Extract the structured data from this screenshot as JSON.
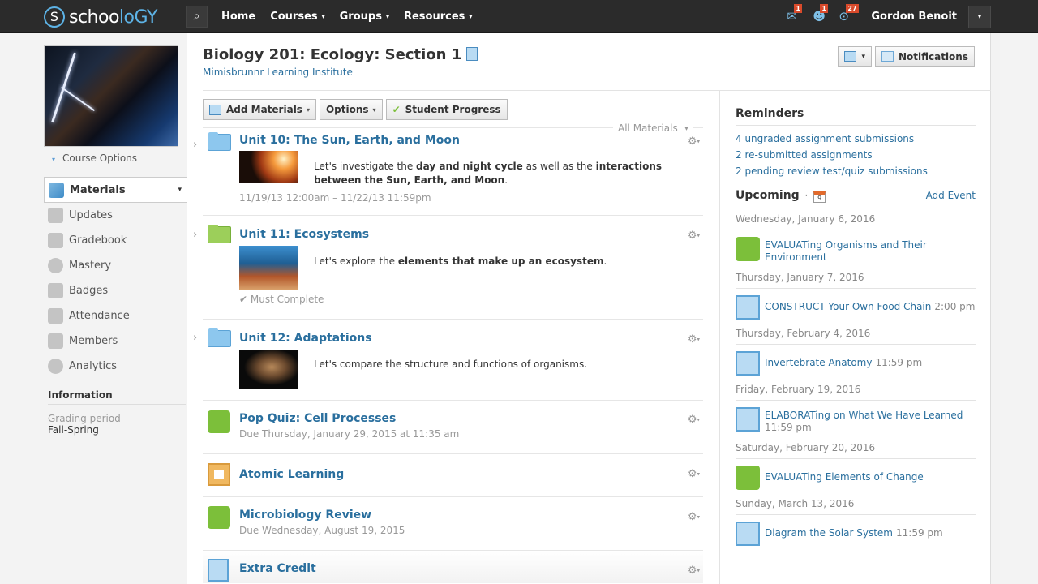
{
  "topbar": {
    "logo_letter": "S",
    "logo_text_main": "schoo",
    "logo_text_accent": "lοGY",
    "search_icon": "⌕",
    "nav": [
      {
        "label": "Home",
        "has_menu": false
      },
      {
        "label": "Courses",
        "has_menu": true
      },
      {
        "label": "Groups",
        "has_menu": true
      },
      {
        "label": "Resources",
        "has_menu": true
      }
    ],
    "caret": "▾",
    "icons": [
      {
        "name": "messages-icon",
        "glyph": "✉",
        "count": "1"
      },
      {
        "name": "requests-icon",
        "glyph": "☻",
        "count": "1"
      },
      {
        "name": "notifications-icon",
        "glyph": "⊙",
        "count": "27"
      }
    ],
    "user_name": "Gordon Benoit",
    "user_menu_caret": "▾"
  },
  "sidebar": {
    "course_options": "Course Options",
    "course_options_caret": "▾",
    "items": [
      {
        "label": "Materials",
        "active": true,
        "icon": "materials-icon"
      },
      {
        "label": "Updates",
        "active": false,
        "icon": "updates-icon"
      },
      {
        "label": "Gradebook",
        "active": false,
        "icon": "gradebook-icon"
      },
      {
        "label": "Mastery",
        "active": false,
        "icon": "mastery-icon"
      },
      {
        "label": "Badges",
        "active": false,
        "icon": "badges-icon"
      },
      {
        "label": "Attendance",
        "active": false,
        "icon": "attendance-icon"
      },
      {
        "label": "Members",
        "active": false,
        "icon": "members-icon"
      },
      {
        "label": "Analytics",
        "active": false,
        "icon": "analytics-icon"
      }
    ],
    "materials_caret": "▾",
    "information": {
      "heading": "Information",
      "grading_period_label": "Grading period",
      "grading_period_value": "Fall-Spring"
    }
  },
  "header": {
    "title": "Biology 201: Ecology: Section 1",
    "school": "Mimisbrunnr Learning Institute",
    "notebook_caret": "▾",
    "notifications_label": "Notifications"
  },
  "toolbar": {
    "add_materials": "Add Materials",
    "options": "Options",
    "student_progress": "Student Progress",
    "caret": "▾",
    "check": "✔",
    "filter_label": "All Materials",
    "filter_caret": "▾"
  },
  "materials": [
    {
      "type": "folder",
      "color": "blue",
      "title": "Unit 10: The Sun, Earth, and Moon",
      "desc_html": "Let's investigate the <b>day and night cycle</b> as well as the <b>interactions between the Sun, Earth, and Moon</b>.",
      "sub": "11/19/13 12:00am – 11/22/13 11:59pm",
      "thumb": "space"
    },
    {
      "type": "folder",
      "color": "green",
      "title": "Unit 11: Ecosystems",
      "desc_html": "Let's explore the <b>elements that make up an ecosystem</b>.",
      "sub": "✔ Must Complete",
      "thumb": "reef"
    },
    {
      "type": "folder",
      "color": "blue",
      "title": "Unit 12: Adaptations",
      "desc_html": "Let's compare the structure and functions of organisms.",
      "sub": "",
      "thumb": "platypus"
    },
    {
      "type": "quiz",
      "title": "Pop Quiz: Cell Processes",
      "sub": "Due Thursday, January 29, 2015 at 11:35 am"
    },
    {
      "type": "external",
      "title": "Atomic Learning",
      "sub": ""
    },
    {
      "type": "quiz",
      "title": "Microbiology Review",
      "sub": "Due Wednesday, August 19, 2015"
    },
    {
      "type": "assignment",
      "title": "Extra Credit",
      "sub": ""
    }
  ],
  "gear": "⚙",
  "expand": "›",
  "reminders": {
    "heading": "Reminders",
    "items": [
      "4 ungraded assignment submissions",
      "2 re-submitted assignments",
      "2 pending review test/quiz submissions"
    ]
  },
  "upcoming": {
    "heading": "Upcoming",
    "separator": "·",
    "calendar_day": "9",
    "add_event": "Add Event",
    "groups": [
      {
        "date": "Wednesday, January 6, 2016",
        "events": [
          {
            "type": "quiz",
            "title": "EVALUATing Organisms and Their Environment",
            "time": ""
          }
        ]
      },
      {
        "date": "Thursday, January 7, 2016",
        "events": [
          {
            "type": "assignment",
            "title": "CONSTRUCT Your Own Food Chain",
            "time": "2:00 pm"
          }
        ]
      },
      {
        "date": "Thursday, February 4, 2016",
        "events": [
          {
            "type": "assignment",
            "title": "Invertebrate Anatomy",
            "time": "11:59 pm"
          }
        ]
      },
      {
        "date": "Friday, February 19, 2016",
        "events": [
          {
            "type": "assignment",
            "title": "ELABORATing on What We Have Learned",
            "time": "11:59 pm"
          }
        ]
      },
      {
        "date": "Saturday, February 20, 2016",
        "events": [
          {
            "type": "quiz",
            "title": "EVALUATing Elements of Change",
            "time": ""
          }
        ]
      },
      {
        "date": "Sunday, March 13, 2016",
        "events": [
          {
            "type": "assignment",
            "title": "Diagram the Solar System",
            "time": "11:59 pm"
          }
        ]
      }
    ]
  },
  "colors": {
    "link": "#2a6f9e",
    "topbar": "#2b2b2b",
    "badge": "#d94a2b",
    "logo_accent": "#5db3e6"
  }
}
